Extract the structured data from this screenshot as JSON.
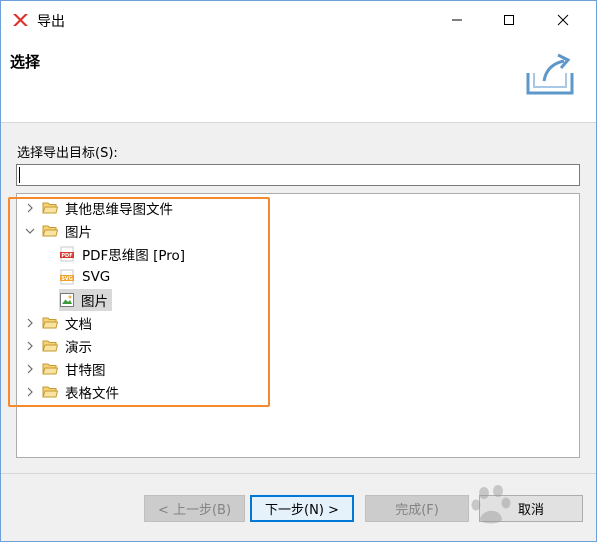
{
  "window": {
    "title": "导出"
  },
  "header": {
    "title": "选择"
  },
  "target": {
    "label": "选择导出目标(S):",
    "search_value": ""
  },
  "tree": {
    "items": [
      {
        "label": "其他思维导图文件",
        "icon": "folder-icon",
        "expanded": false,
        "level": 0
      },
      {
        "label": "图片",
        "icon": "folder-icon",
        "expanded": true,
        "level": 0
      },
      {
        "label": "PDF思维图 [Pro]",
        "icon": "pdf-icon",
        "level": 1
      },
      {
        "label": "SVG",
        "icon": "svg-icon",
        "level": 1
      },
      {
        "label": "图片",
        "icon": "image-icon",
        "level": 1,
        "selected": true
      },
      {
        "label": "文档",
        "icon": "folder-icon",
        "expanded": false,
        "level": 0
      },
      {
        "label": "演示",
        "icon": "folder-icon",
        "expanded": false,
        "level": 0
      },
      {
        "label": "甘特图",
        "icon": "folder-icon",
        "expanded": false,
        "level": 0
      },
      {
        "label": "表格文件",
        "icon": "folder-icon",
        "expanded": false,
        "level": 0
      }
    ]
  },
  "footer": {
    "back_label": "< 上一步(B)",
    "next_label": "下一步(N) >",
    "finish_label": "完成(F)",
    "cancel_label": "取消"
  },
  "colors": {
    "highlight": "#f5892f",
    "accent": "#0078d7",
    "folder": "#e8b64a",
    "app_logo": "#e0312b"
  }
}
